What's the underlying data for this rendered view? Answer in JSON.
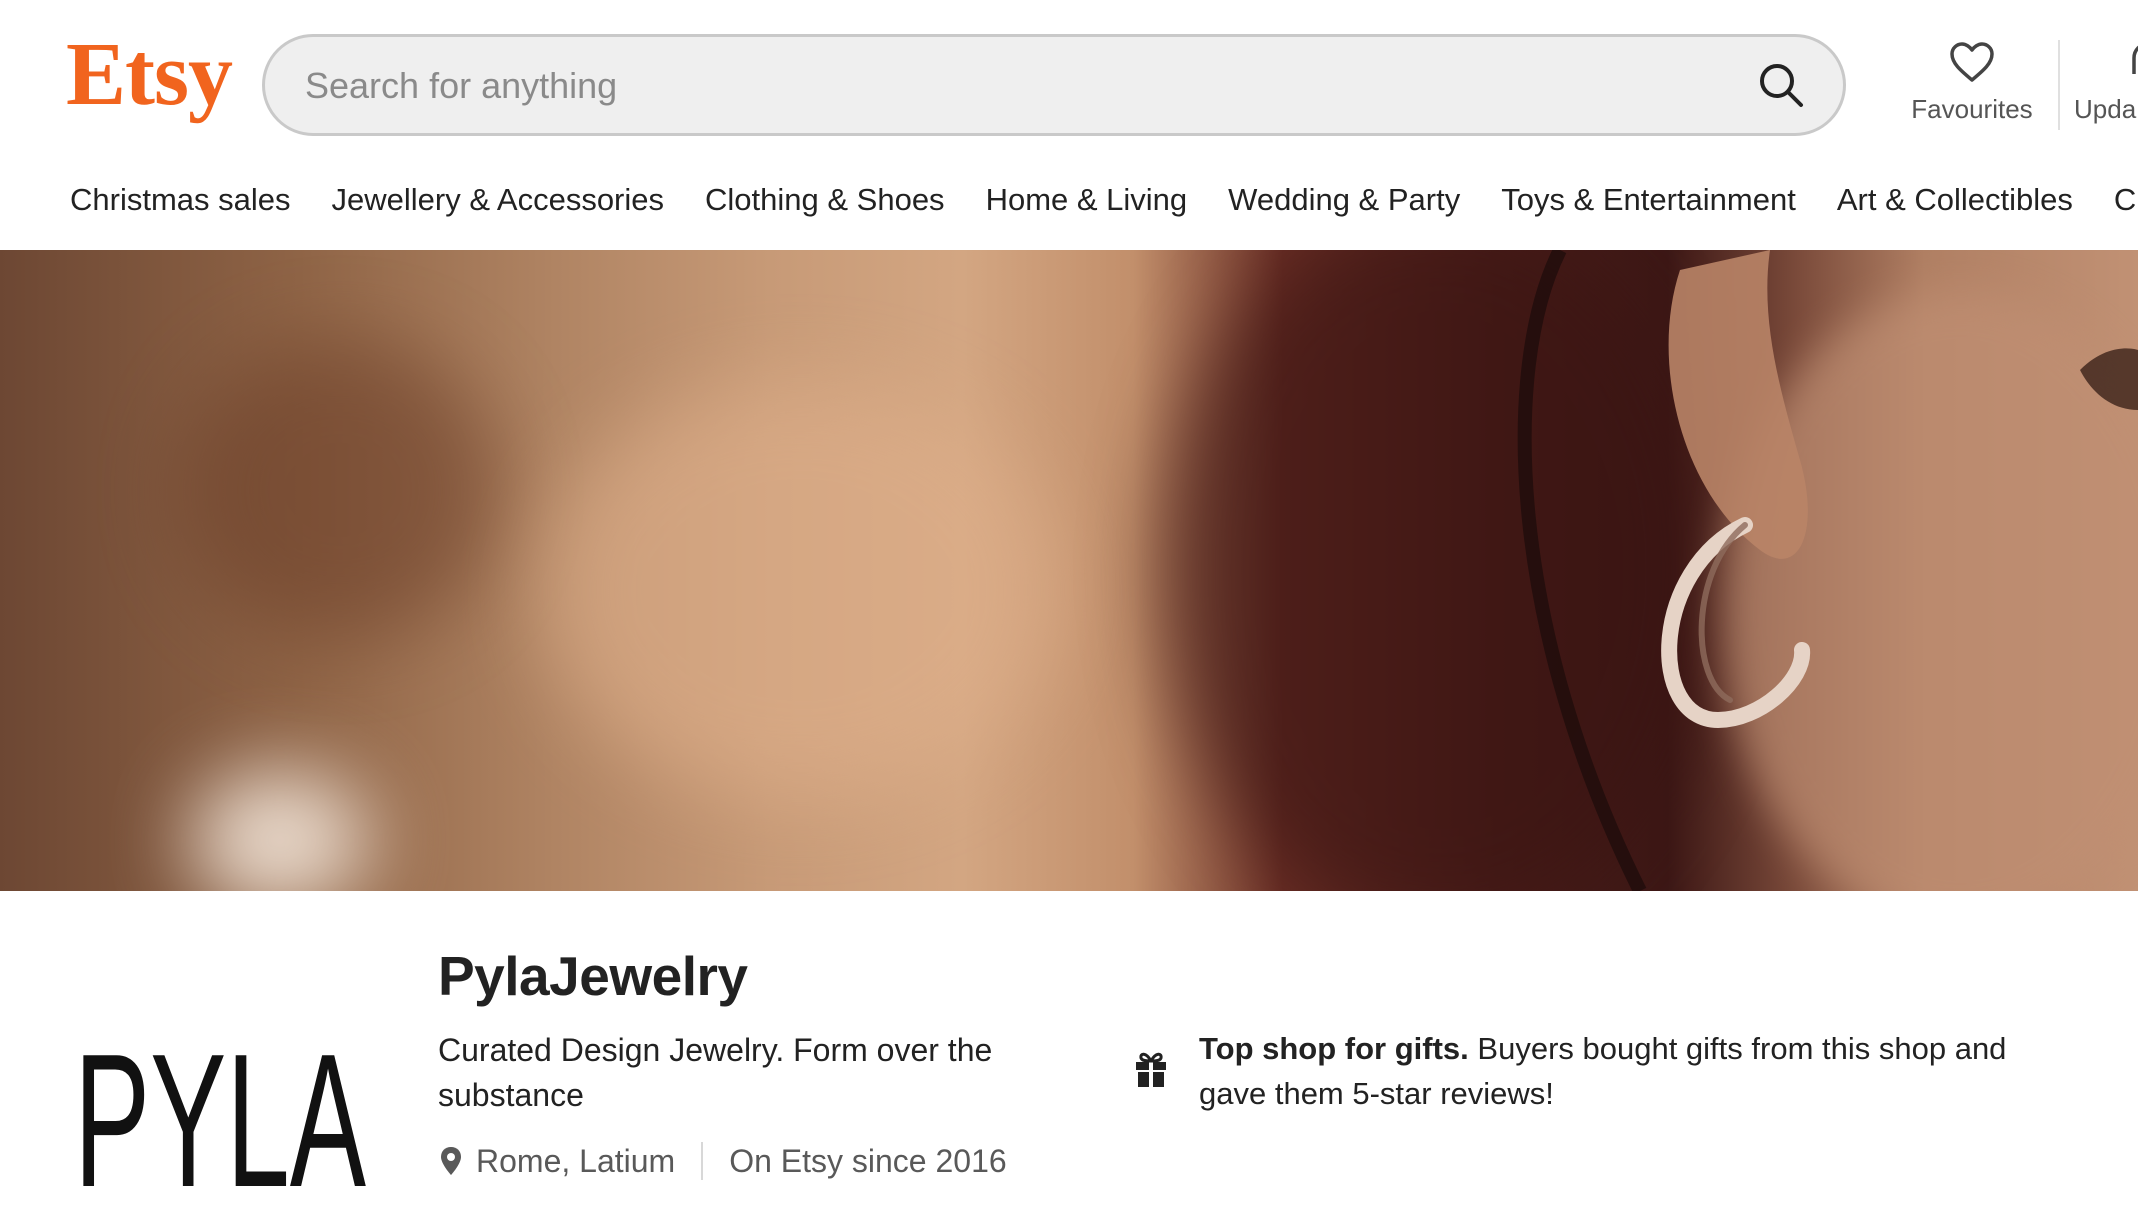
{
  "header": {
    "logo_text": "Etsy",
    "search_placeholder": "Search for anything",
    "favourites_label": "Favourites",
    "updates_label": "Upda",
    "brand_color": "#f1641e"
  },
  "nav": {
    "items": [
      "Christmas sales",
      "Jewellery & Accessories",
      "Clothing & Shoes",
      "Home & Living",
      "Wedding & Party",
      "Toys & Entertainment",
      "Art & Collectibles",
      "Cra"
    ]
  },
  "banner": {
    "description": "photo"
  },
  "shop": {
    "logo_text": "PYLA",
    "name": "PylaJewelry",
    "tagline": "Curated Design Jewelry. Form over the substance",
    "location": "Rome, Latium",
    "since": "On Etsy since 2016",
    "badge_title": "Top shop for gifts.",
    "badge_body": "Buyers bought gifts from this shop and gave them 5-star reviews!"
  },
  "icons": {
    "search": "search-icon",
    "favourites": "heart-icon",
    "updates": "bell-icon",
    "location": "location-pin-icon",
    "gift": "gift-icon"
  }
}
